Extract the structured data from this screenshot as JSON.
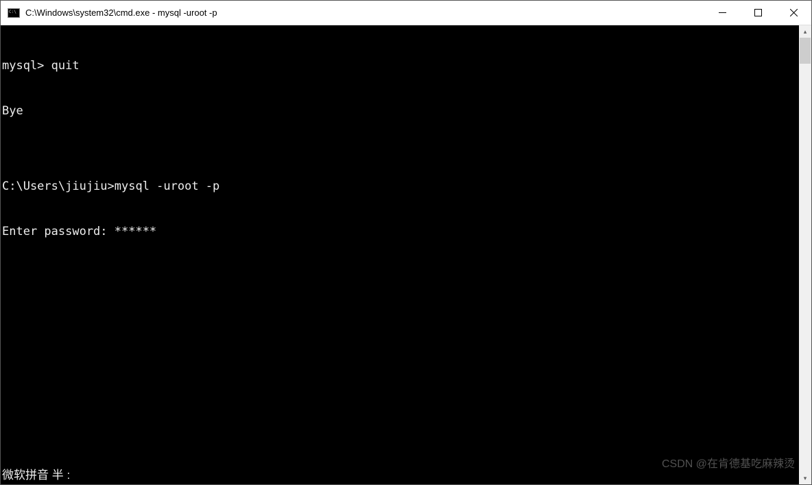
{
  "window": {
    "title": "C:\\Windows\\system32\\cmd.exe - mysql  -uroot -p"
  },
  "terminal": {
    "lines": [
      "mysql> quit",
      "Bye",
      "",
      "C:\\Users\\jiujiu>mysql -uroot -p",
      "Enter password: ******"
    ],
    "ime_status": "微软拼音 半 :"
  },
  "watermark": "CSDN @在肯德基吃麻辣烫"
}
